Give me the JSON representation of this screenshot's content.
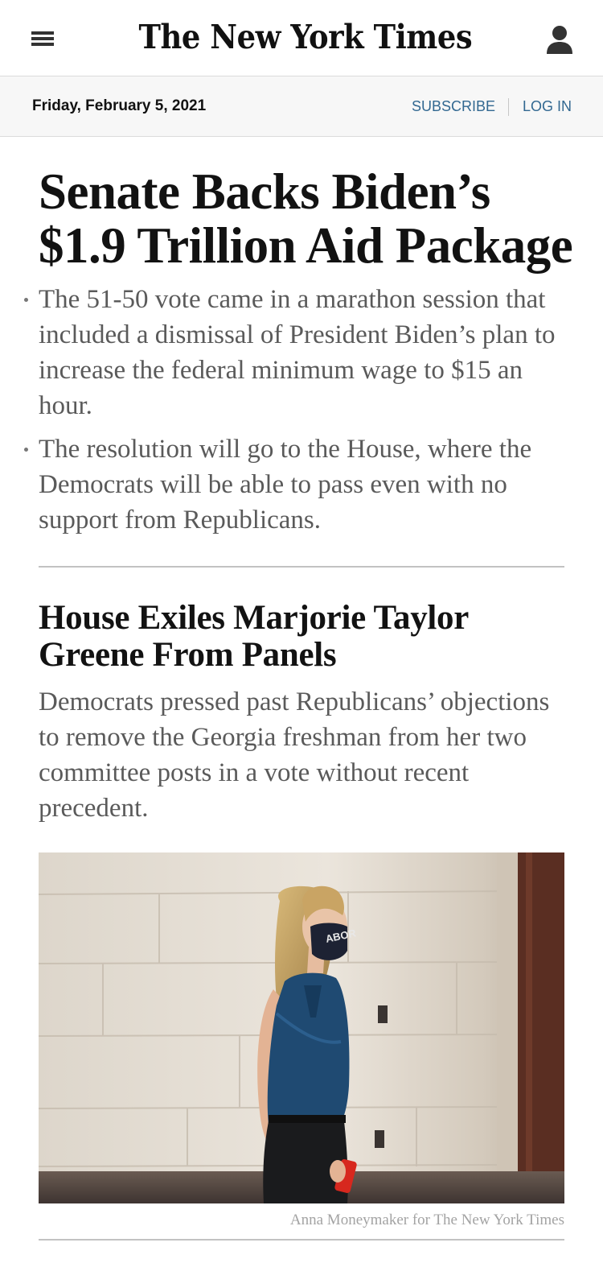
{
  "header": {
    "masthead": "The New York Times",
    "menu_icon": "hamburger-menu-icon",
    "account_icon": "user-account-icon"
  },
  "datebar": {
    "date": "Friday, February 5, 2021",
    "subscribe_label": "SUBSCRIBE",
    "login_label": "LOG IN"
  },
  "story1": {
    "headline": "Senate Backs Biden’s $1.9 Trillion Aid Package",
    "bullets": [
      "The 51-50 vote came in a marathon session that included a dismissal of President Biden’s plan to increase the federal minimum wage to $15 an hour.",
      "The resolution will go to the House, where the Democrats will be able to pass even with no support from Republicans."
    ]
  },
  "story2": {
    "headline": "House Exiles Marjorie Taylor Greene From Panels",
    "summary": "Democrats pressed past Republicans’ objections to remove the Georgia freshman from her two committee posts in a vote without recent precedent.",
    "photo": {
      "mask_text": "ABOR",
      "credit": "Anna Moneymaker for The New York Times"
    }
  },
  "colors": {
    "link": "#326891",
    "text": "#121212",
    "summary": "#5a5a5a",
    "datebar_bg": "#f7f7f7",
    "credit": "#a3a3a3"
  }
}
